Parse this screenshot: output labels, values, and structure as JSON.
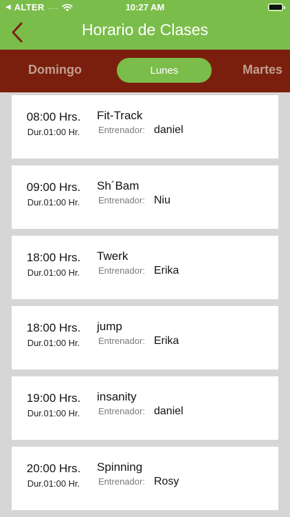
{
  "status_bar": {
    "carrier": "ALTER",
    "signal": "....",
    "time": "10:27 AM"
  },
  "nav": {
    "title": "Horario de Clases"
  },
  "days": {
    "prev": "Domingo",
    "active": "Lunes",
    "next": "Martes"
  },
  "classes": [
    {
      "time": "08:00 Hrs.",
      "duration": "Dur.01:00 Hr.",
      "name": "Fit-Track",
      "trainer_label": "Entrenador:",
      "trainer": "daniel"
    },
    {
      "time": "09:00 Hrs.",
      "duration": "Dur.01:00 Hr.",
      "name": "Sh´Bam",
      "trainer_label": "Entrenador:",
      "trainer": "Niu"
    },
    {
      "time": "18:00 Hrs.",
      "duration": "Dur.01:00 Hr.",
      "name": "Twerk",
      "trainer_label": "Entrenador:",
      "trainer": "Erika"
    },
    {
      "time": "18:00 Hrs.",
      "duration": "Dur.01:00 Hr.",
      "name": "jump",
      "trainer_label": "Entrenador:",
      "trainer": "Erika"
    },
    {
      "time": "19:00 Hrs.",
      "duration": "Dur.01:00 Hr.",
      "name": "insanity",
      "trainer_label": "Entrenador:",
      "trainer": "daniel"
    },
    {
      "time": "20:00 Hrs.",
      "duration": "Dur.01:00 Hr.",
      "name": "Spinning",
      "trainer_label": "Entrenador:",
      "trainer": "Rosy"
    }
  ]
}
